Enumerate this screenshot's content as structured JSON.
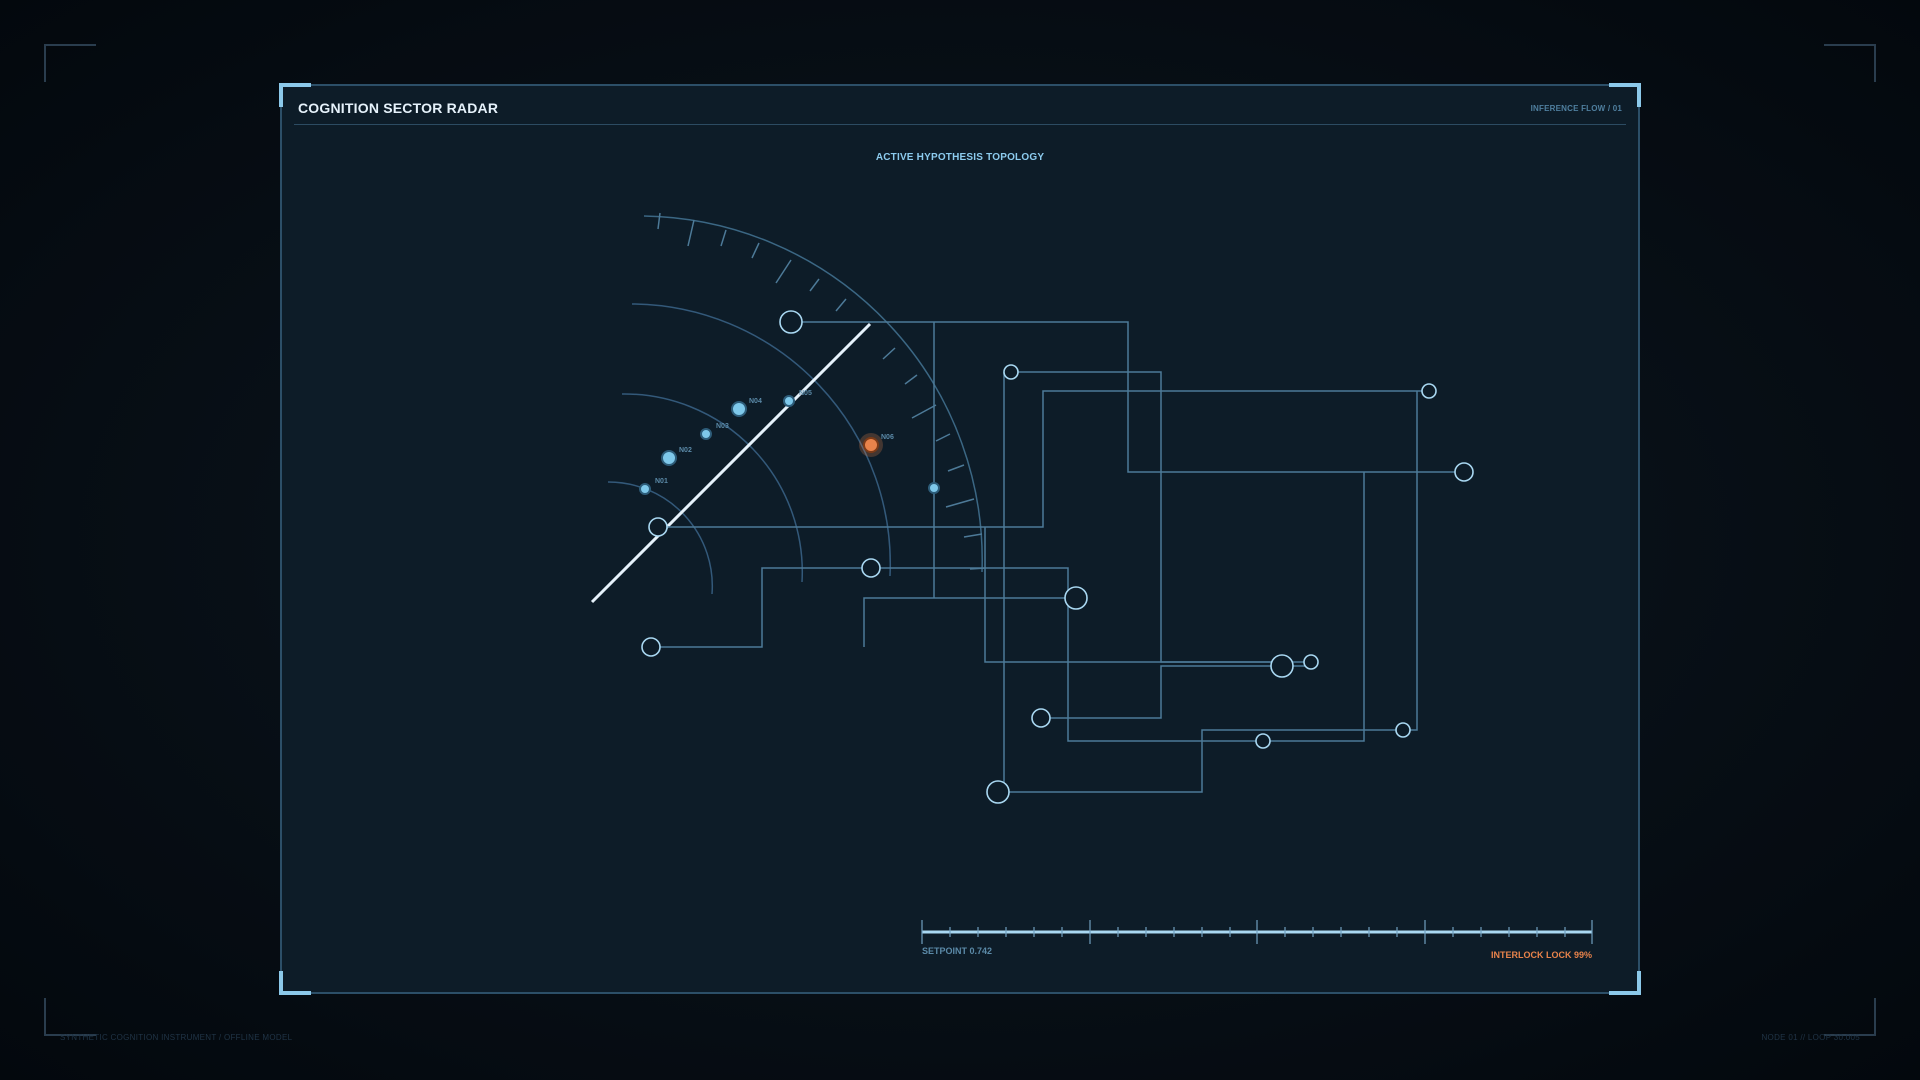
{
  "panel": {
    "title": "COGNITION SECTOR RADAR",
    "subtitle": "INFERENCE FLOW / 01",
    "section_label": "ACTIVE HYPOTHESIS TOPOLOGY"
  },
  "nodes": [
    {
      "id": "N01",
      "label": "N01",
      "state": "normal"
    },
    {
      "id": "N02",
      "label": "N02",
      "state": "normal"
    },
    {
      "id": "N03",
      "label": "N03",
      "state": "normal"
    },
    {
      "id": "N04",
      "label": "N04",
      "state": "normal"
    },
    {
      "id": "N05",
      "label": "N05",
      "state": "normal"
    },
    {
      "id": "N06",
      "label": "N06",
      "state": "alert"
    }
  ],
  "footer": {
    "setpoint": "SETPOINT 0.742",
    "interlock": "INTERLOCK LOCK  99%",
    "left": "SYNTHETIC COGNITION INSTRUMENT / OFFLINE MODEL",
    "right": "NODE 01 // LOOP 30.005"
  },
  "colors": {
    "background": "#060d14",
    "panel": "#0d1c28",
    "accent": "#8ccbee",
    "alert": "#e8834b",
    "line": "#4d7a98"
  },
  "icons": {
    "node": "circle-node-icon",
    "alert": "alert-node-icon"
  }
}
